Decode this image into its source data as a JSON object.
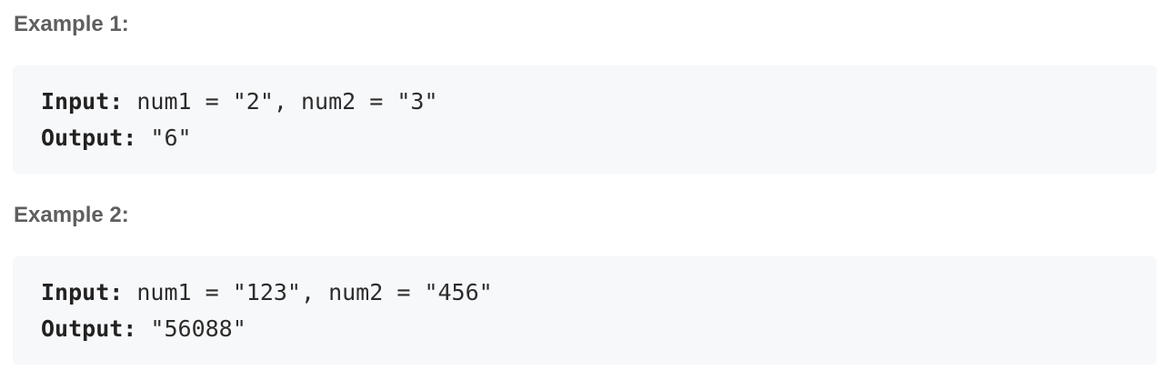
{
  "examples": [
    {
      "heading": "Example 1:",
      "input_label": "Input:",
      "input_value": " num1 = \"2\", num2 = \"3\"",
      "output_label": "Output:",
      "output_value": " \"6\""
    },
    {
      "heading": "Example 2:",
      "input_label": "Input:",
      "input_value": " num1 = \"123\", num2 = \"456\"",
      "output_label": "Output:",
      "output_value": " \"56088\""
    }
  ]
}
